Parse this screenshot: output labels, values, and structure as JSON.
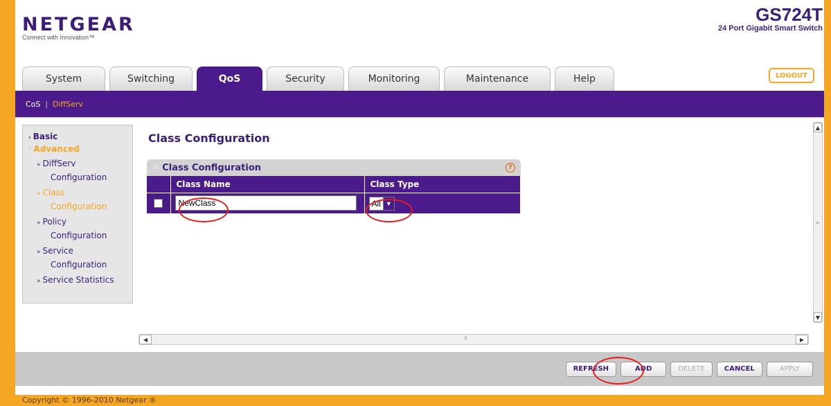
{
  "header": {
    "logo_text": "NETGEAR",
    "logo_tagline": "Connect with Innovation™",
    "model_name": "GS724T",
    "model_desc": "24 Port Gigabit Smart Switch"
  },
  "tabs": [
    {
      "label": "System"
    },
    {
      "label": "Switching"
    },
    {
      "label": "QoS"
    },
    {
      "label": "Security"
    },
    {
      "label": "Monitoring"
    },
    {
      "label": "Maintenance"
    },
    {
      "label": "Help"
    }
  ],
  "logout_label": "LOGOUT",
  "subnav": {
    "cos": "CoS",
    "separator": "|",
    "diffserv": "DiffServ"
  },
  "sidebar": {
    "basic": "Basic",
    "advanced": "Advanced",
    "items": [
      {
        "line1": "DiffServ",
        "line2": "Configuration"
      },
      {
        "line1": "Class",
        "line2": "Configuration"
      },
      {
        "line1": "Policy",
        "line2": "Configuration"
      },
      {
        "line1": "Service",
        "line2": "Configuration"
      },
      {
        "line1": "Service Statistics",
        "line2": ""
      }
    ]
  },
  "main": {
    "page_title": "Class Configuration",
    "panel_title": "Class Configuration",
    "help_glyph": "?",
    "columns": [
      "Class Name",
      "Class Type"
    ],
    "row": {
      "class_name": "NewClass",
      "class_type": "All"
    }
  },
  "buttons": {
    "refresh": "REFRESH",
    "add": "ADD",
    "delete": "DELETE",
    "cancel": "CANCEL",
    "apply": "APPLY"
  },
  "copyright": "Copyright © 1996-2010 Netgear ®",
  "colors": {
    "brand_purple": "#4b1b8c",
    "accent_orange": "#f5a623",
    "highlight_red": "#e61b1b"
  }
}
